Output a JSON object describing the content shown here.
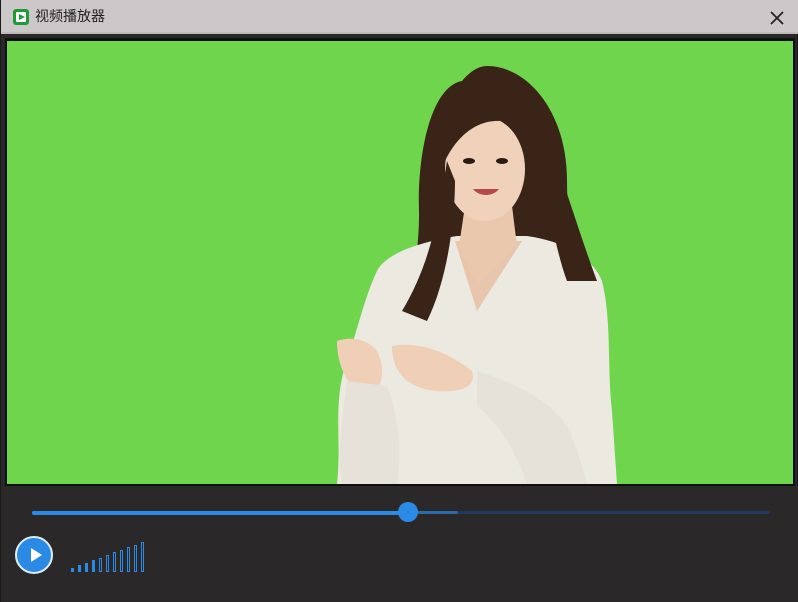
{
  "window": {
    "title": "视频播放器",
    "app_icon": "video-play-icon",
    "close_icon": "close-icon"
  },
  "video": {
    "background_color": "#6fd54d",
    "scene": "presenter-woman-green-screen"
  },
  "playback": {
    "state": "paused",
    "progress": 0.509,
    "buffered": 0.577,
    "play_icon": "play-icon",
    "accent_color": "#2a8ae6"
  },
  "volume": {
    "level_bars": 4,
    "total_bars": 11,
    "icon": "volume-bars-icon"
  }
}
